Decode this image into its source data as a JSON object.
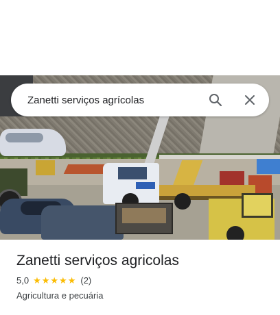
{
  "search": {
    "query": "Zanetti serviços agrícolas",
    "search_icon": "search-icon",
    "close_icon": "close-icon"
  },
  "place": {
    "name": "Zanetti serviços agricolas",
    "rating": "5,0",
    "stars": 5,
    "review_count": "(2)",
    "category": "Agricultura e pecuária"
  },
  "colors": {
    "star": "#fbbc04",
    "text_primary": "#202124",
    "text_secondary": "#3c4043"
  }
}
